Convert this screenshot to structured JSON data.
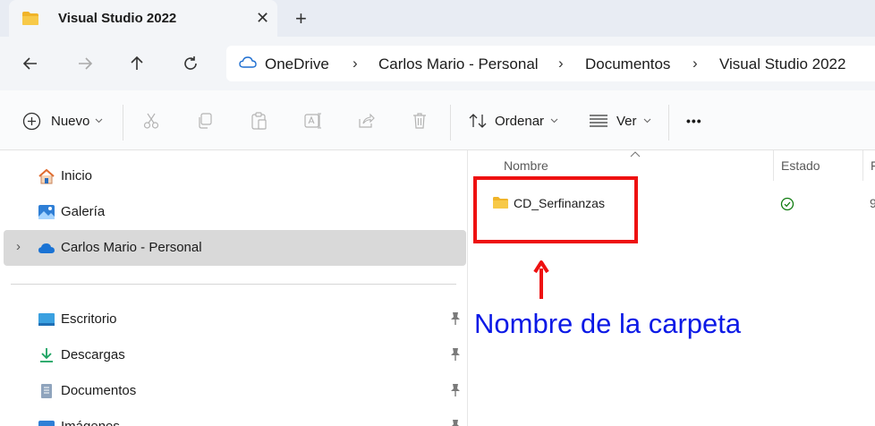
{
  "tab": {
    "title": "Visual Studio 2022",
    "close": "✕",
    "new_tab": "+"
  },
  "nav_buttons": {
    "back": "back-arrow-icon",
    "forward": "forward-arrow-icon",
    "up": "up-arrow-icon",
    "refresh": "refresh-icon"
  },
  "breadcrumbs": [
    {
      "label": "OneDrive"
    },
    {
      "label": "Carlos Mario - Personal"
    },
    {
      "label": "Documentos"
    },
    {
      "label": "Visual Studio 2022"
    }
  ],
  "breadcrumb_separator": "›",
  "commands": {
    "new_label": "Nuevo",
    "sort_label": "Ordenar",
    "view_label": "Ver",
    "more_label": "•••"
  },
  "sidebar": {
    "items": [
      {
        "label": "Inicio",
        "icon": "home-icon"
      },
      {
        "label": "Galería",
        "icon": "gallery-icon"
      },
      {
        "label": "Carlos Mario - Personal",
        "icon": "onedrive-cloud-icon",
        "selected": true,
        "expander": "›"
      },
      {
        "label": "Escritorio",
        "icon": "desktop-icon",
        "pinned": true
      },
      {
        "label": "Descargas",
        "icon": "download-icon",
        "pinned": true
      },
      {
        "label": "Documentos",
        "icon": "document-icon",
        "pinned": true
      },
      {
        "label": "Imágenes",
        "icon": "pictures-icon",
        "pinned": true
      }
    ]
  },
  "columns": {
    "name": "Nombre",
    "status": "Estado",
    "next": "F"
  },
  "files": [
    {
      "name": "CD_Serfinanzas",
      "type": "folder",
      "status": "synced",
      "truncated_value": "9"
    }
  ],
  "annotation": {
    "text": "Nombre de la carpeta",
    "box_color": "#ee1111",
    "text_color": "#0b19e6"
  },
  "colors": {
    "accent": "#0067c0",
    "folder": "#f7c948",
    "sync_ok": "#107c10"
  }
}
